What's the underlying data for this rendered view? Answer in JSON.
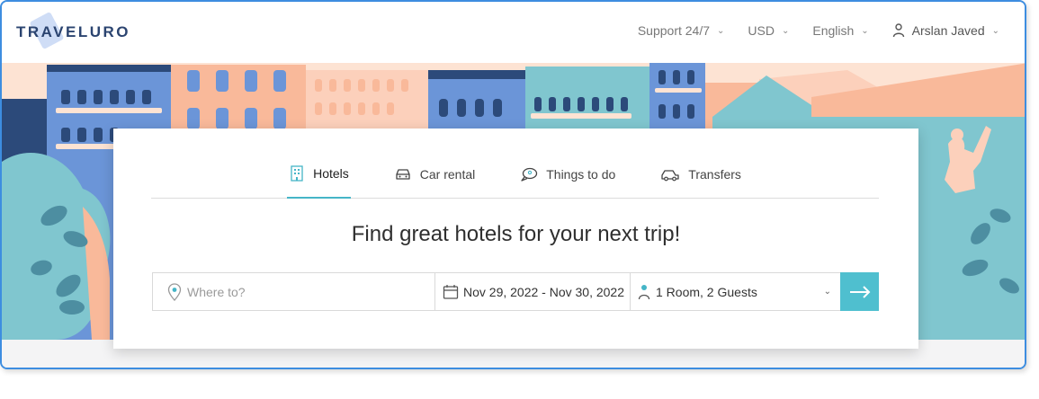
{
  "header": {
    "logo": "TRAVELURO",
    "support": "Support 24/7",
    "currency": "USD",
    "language": "English",
    "user_name": "Arslan Javed"
  },
  "tabs": [
    {
      "label": "Hotels",
      "icon": "building-icon",
      "active": true
    },
    {
      "label": "Car rental",
      "icon": "car-icon",
      "active": false
    },
    {
      "label": "Things to do",
      "icon": "chat-icon",
      "active": false
    },
    {
      "label": "Transfers",
      "icon": "taxi-icon",
      "active": false
    }
  ],
  "headline": "Find great hotels for your next trip!",
  "search": {
    "where_placeholder": "Where to?",
    "dates": "Nov 29, 2022 - Nov 30, 2022",
    "guests": "1 Room, 2 Guests"
  },
  "colors": {
    "accent": "#4fbfcf",
    "logo": "#2b4470",
    "border": "#3d8de0"
  }
}
